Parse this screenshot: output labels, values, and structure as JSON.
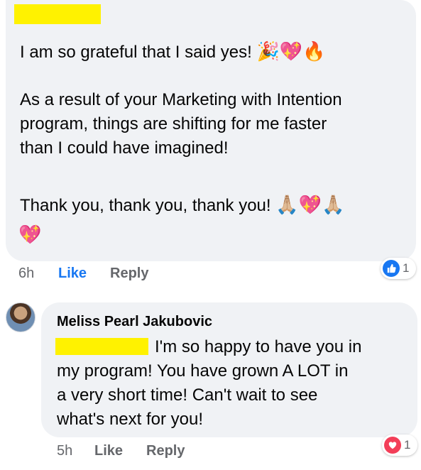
{
  "comment1": {
    "lines": [
      "I am so grateful that I said yes!",
      "As a result of your Marketing with Intention",
      "program, things are shifting for me faster",
      "than I could have imagined!",
      "Thank you, thank you, thank you!"
    ],
    "emoji_line1": "🎉💖🔥",
    "emoji_line5": "🙏🏼💖🙏🏼",
    "emoji_line6": "💖",
    "time": "6h",
    "like_label": "Like",
    "reply_label": "Reply",
    "reaction": {
      "type": "like",
      "count": "1",
      "color": "#1877f2"
    }
  },
  "comment2": {
    "author": "Meliss Pearl Jakubovic",
    "lines": [
      "I'm so happy to have you in",
      "my program!  You have grown A LOT in",
      "a very short time!  Can't wait to see",
      "what's next for you!"
    ],
    "time": "5h",
    "like_label": "Like",
    "reply_label": "Reply",
    "reaction": {
      "type": "love",
      "count": "1",
      "color": "#f33e58"
    }
  },
  "redaction_color": "#fff200"
}
